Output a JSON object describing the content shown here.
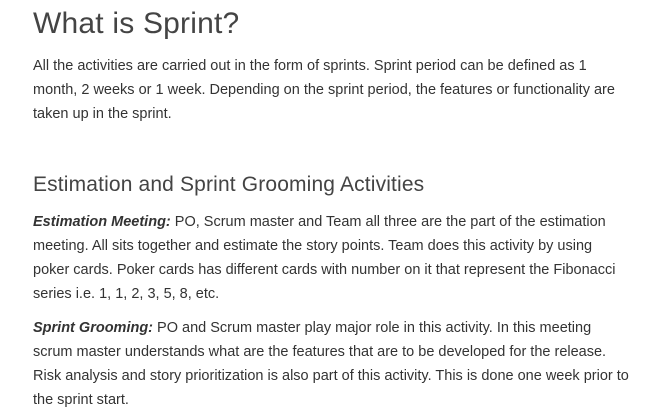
{
  "page": {
    "title": "What is Sprint?",
    "intro": "All the activities are carried out in the form of sprints. Sprint period can be defined as 1 month, 2 weeks or 1 week. Depending on the sprint period, the features or functionality are taken up in the sprint."
  },
  "section": {
    "heading": "Estimation and Sprint Grooming Activities",
    "estimation": {
      "term": "Estimation Meeting:",
      "text": " PO, Scrum master and Team all three are the part of the estimation meeting. All sits together and estimate the story points. Team does this activity by using poker cards. Poker cards has different cards with number on it that represent the Fibonacci series i.e.  1, 1, 2, 3, 5, 8, etc."
    },
    "grooming": {
      "term": "Sprint Grooming:",
      "text": " PO and Scrum master play major role in this activity. In this meeting scrum master understands what are the features that are to be developed for the release. Risk analysis and story prioritization is also part of this activity. This is done one week prior to the sprint start."
    }
  }
}
